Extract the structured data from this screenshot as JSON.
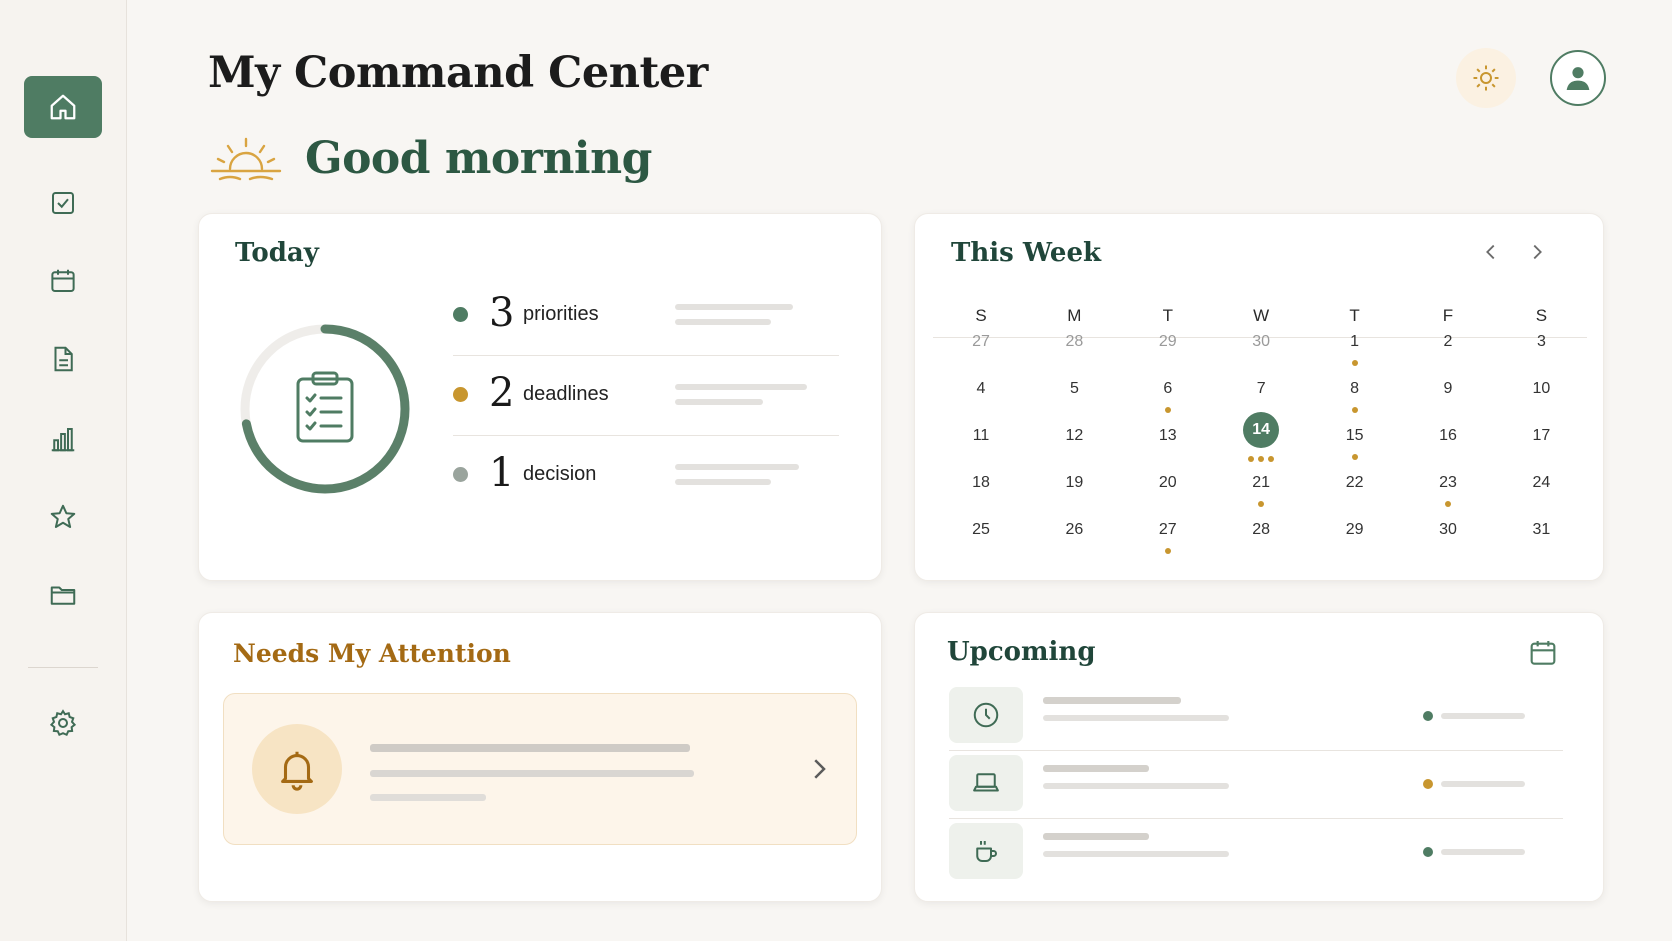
{
  "header": {
    "title": "My Command Center"
  },
  "greeting": {
    "text": "Good morning"
  },
  "sidebar": {
    "items": [
      {
        "icon": "home-icon",
        "active": true
      },
      {
        "icon": "checkbox-icon"
      },
      {
        "icon": "calendar-icon"
      },
      {
        "icon": "document-icon"
      },
      {
        "icon": "bar-chart-icon"
      },
      {
        "icon": "star-icon"
      },
      {
        "icon": "folder-icon"
      },
      {
        "icon": "gear-icon"
      }
    ]
  },
  "today": {
    "title": "Today",
    "progress_fraction": 0.72,
    "stats": [
      {
        "value": "3",
        "label": "priorities",
        "color": "#4f7c63"
      },
      {
        "value": "2",
        "label": "deadlines",
        "color": "#c8962f"
      },
      {
        "value": "1",
        "label": "decision",
        "color": "#9aa49d"
      }
    ]
  },
  "week": {
    "title": "This Week",
    "weekdays": [
      "S",
      "M",
      "T",
      "W",
      "T",
      "F",
      "S"
    ],
    "rows": [
      [
        {
          "d": "27",
          "muted": true
        },
        {
          "d": "28",
          "muted": true
        },
        {
          "d": "29",
          "muted": true
        },
        {
          "d": "30",
          "muted": true
        },
        {
          "d": "1",
          "dots": 1
        },
        {
          "d": "2"
        },
        {
          "d": "3"
        }
      ],
      [
        {
          "d": "4"
        },
        {
          "d": "5"
        },
        {
          "d": "6",
          "dots": 1
        },
        {
          "d": "7"
        },
        {
          "d": "8",
          "dots": 1
        },
        {
          "d": "9"
        },
        {
          "d": "10"
        }
      ],
      [
        {
          "d": "11"
        },
        {
          "d": "12"
        },
        {
          "d": "13"
        },
        {
          "d": "14",
          "today": true,
          "dots": 3
        },
        {
          "d": "15",
          "dots": 1
        },
        {
          "d": "16"
        },
        {
          "d": "17"
        }
      ],
      [
        {
          "d": "18"
        },
        {
          "d": "19"
        },
        {
          "d": "20"
        },
        {
          "d": "21",
          "dots": 1
        },
        {
          "d": "22"
        },
        {
          "d": "23",
          "dots": 1
        },
        {
          "d": "24"
        }
      ],
      [
        {
          "d": "25"
        },
        {
          "d": "26"
        },
        {
          "d": "27",
          "dots": 1
        },
        {
          "d": "28"
        },
        {
          "d": "29"
        },
        {
          "d": "30"
        },
        {
          "d": "31"
        }
      ]
    ]
  },
  "attention": {
    "title": "Needs My Attention"
  },
  "upcoming": {
    "title": "Upcoming",
    "items": [
      {
        "icon": "clock-icon",
        "status_color": "#4f7c63"
      },
      {
        "icon": "laptop-icon",
        "status_color": "#c8962f"
      },
      {
        "icon": "coffee-icon",
        "status_color": "#4f7c63"
      }
    ]
  },
  "colors": {
    "accent": "#4f7c63",
    "gold": "#c8962f",
    "attention": "#a46a14"
  }
}
